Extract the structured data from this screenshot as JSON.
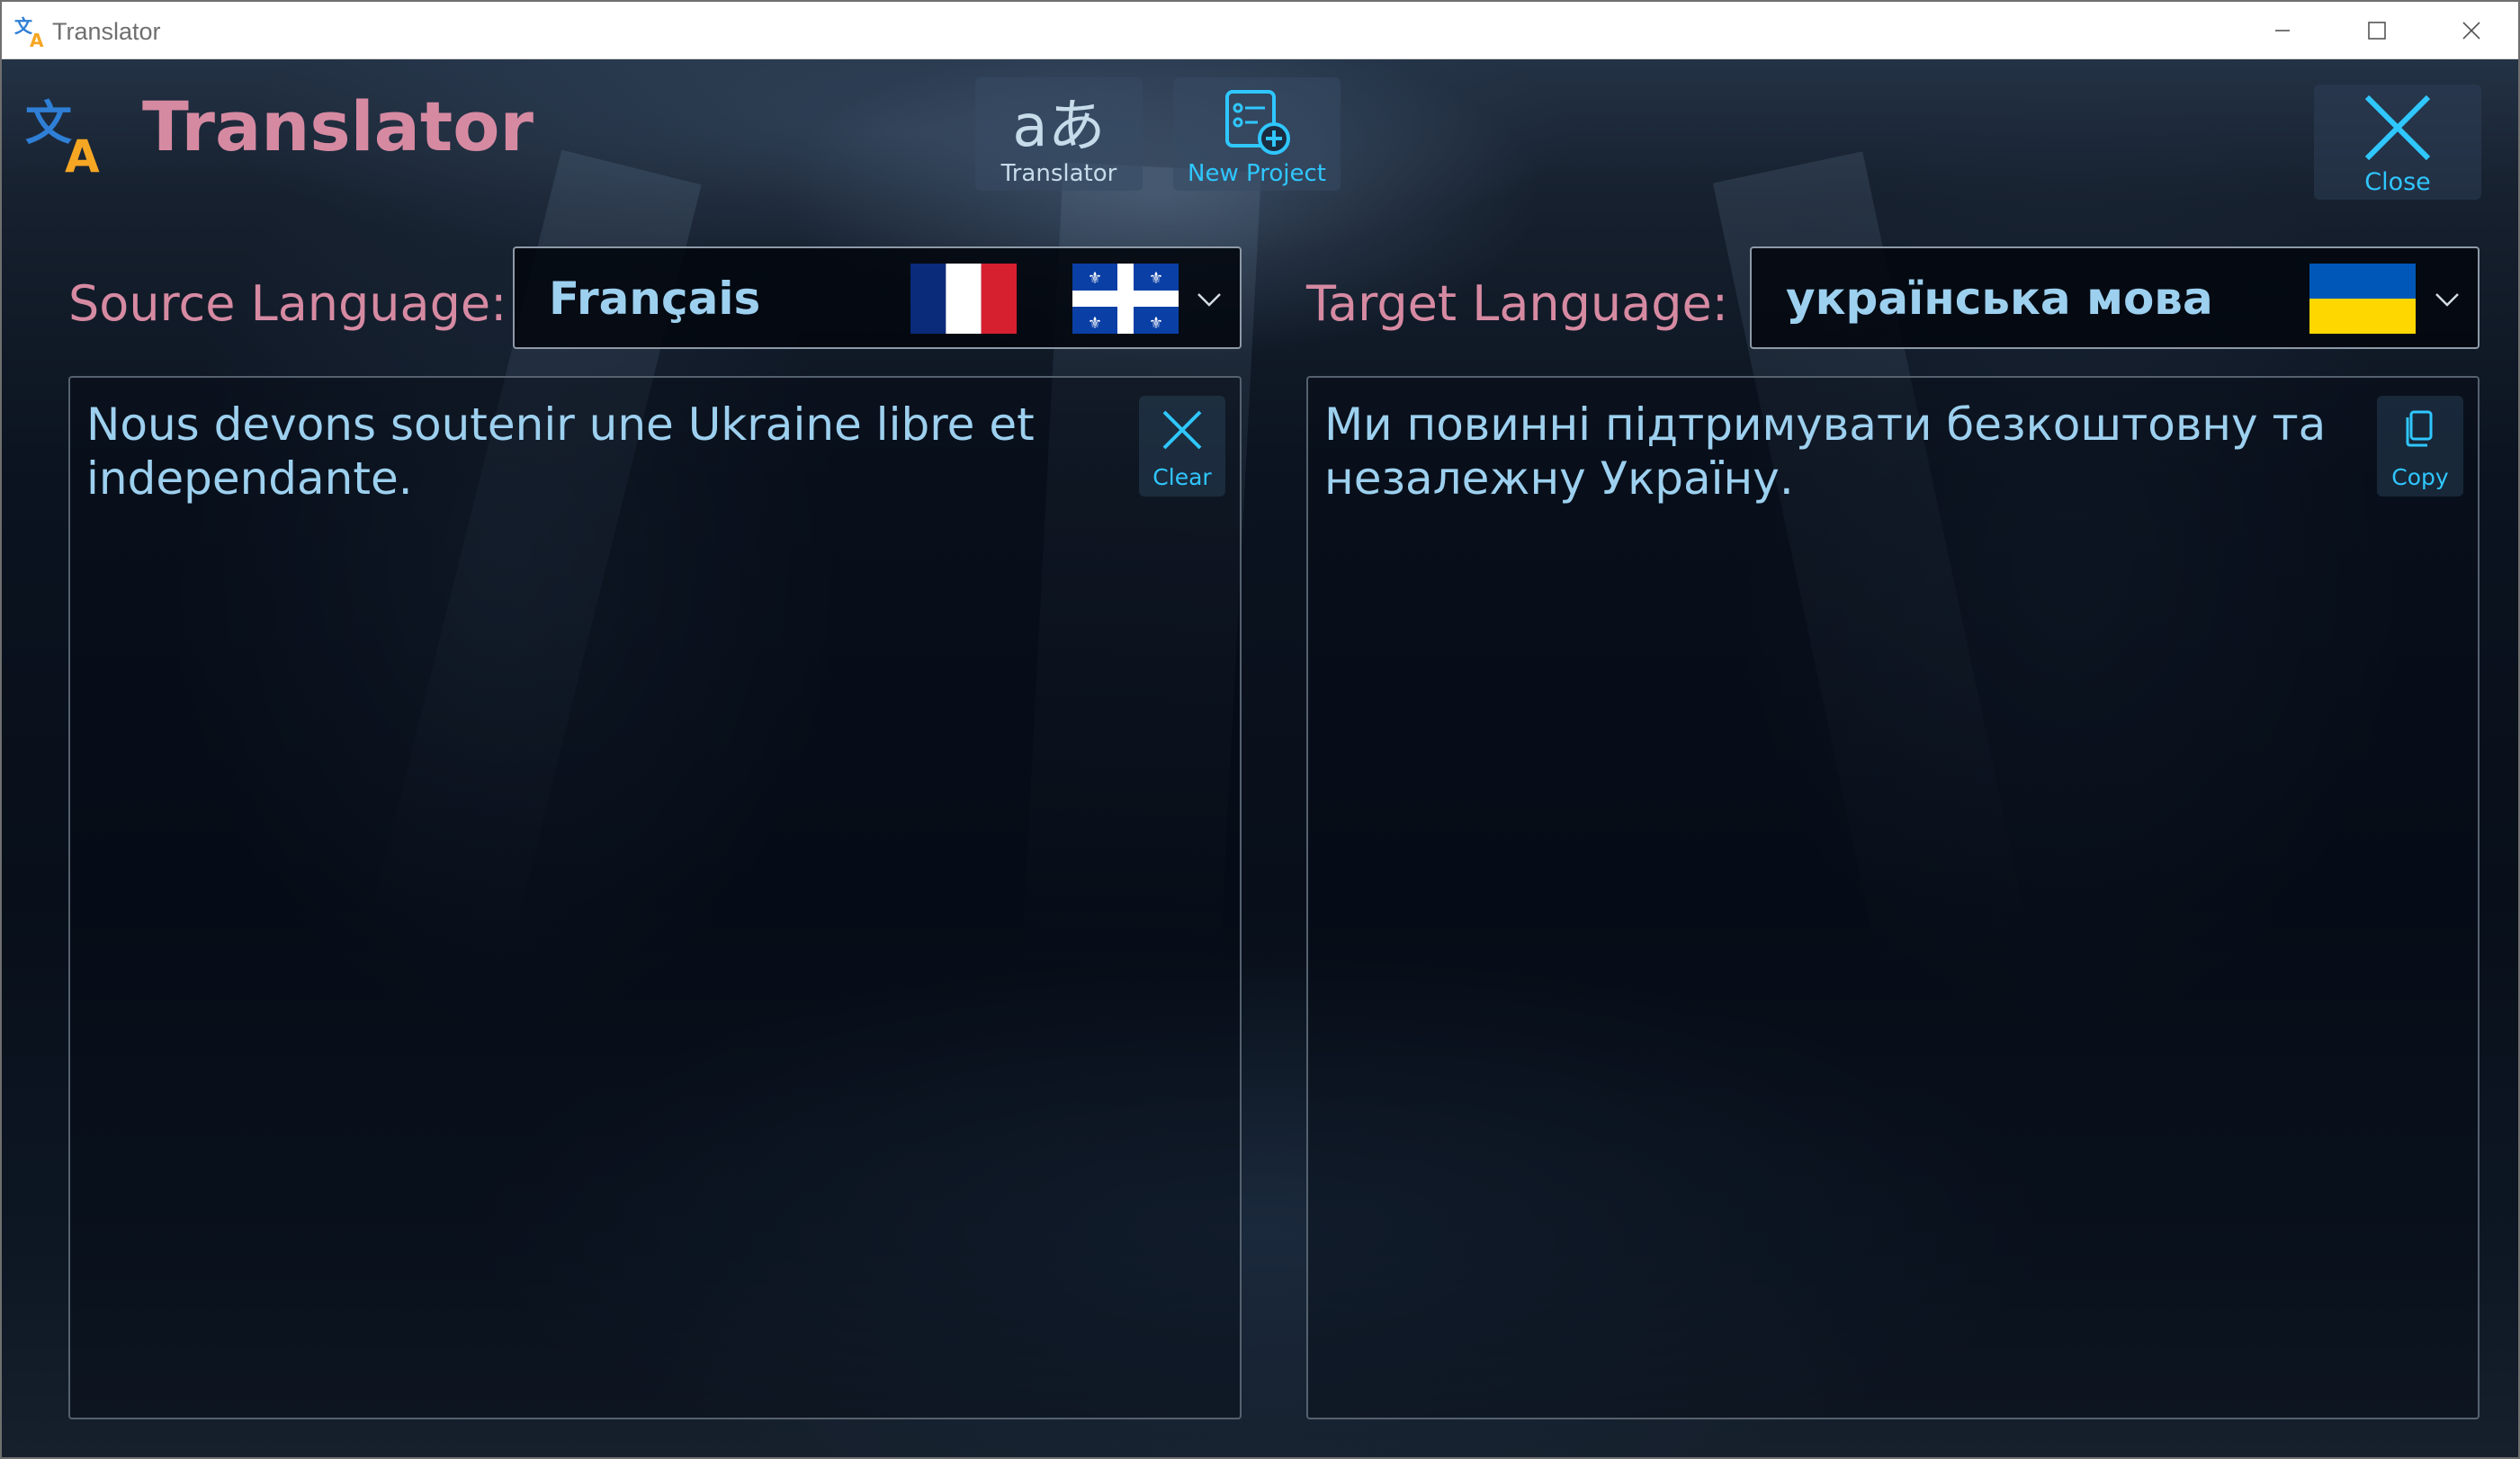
{
  "window": {
    "title": "Translator",
    "controls": [
      "minimize-icon",
      "maximize-icon",
      "close-icon"
    ]
  },
  "header": {
    "app_title": "Translator",
    "logo_icon": "translate-logo-icon",
    "nav": [
      {
        "label": "Translator",
        "icon": "translate-icon"
      },
      {
        "label": "New Project",
        "icon": "new-project-icon"
      }
    ],
    "close": {
      "label": "Close",
      "icon": "close-icon"
    }
  },
  "source": {
    "label": "Source Language:",
    "selected": "Français",
    "flags": [
      "france-flag-icon",
      "quebec-flag-icon"
    ],
    "text": "Nous devons soutenir une Ukraine libre et independante.",
    "action": {
      "label": "Clear",
      "icon": "close-icon"
    }
  },
  "target": {
    "label": "Target Language:",
    "selected": "українська мова",
    "flags": [
      "ukraine-flag-icon"
    ],
    "text": "Ми повинні підтримувати безкоштовну та незалежну Україну.",
    "action": {
      "label": "Copy",
      "icon": "copy-icon"
    }
  },
  "colors": {
    "title_accent": "#d68aa2",
    "text_accent": "#9dd0ef",
    "button_accent": "#2fc7ff",
    "logo_blue": "#2f7fd6",
    "logo_orange": "#f5a623"
  }
}
